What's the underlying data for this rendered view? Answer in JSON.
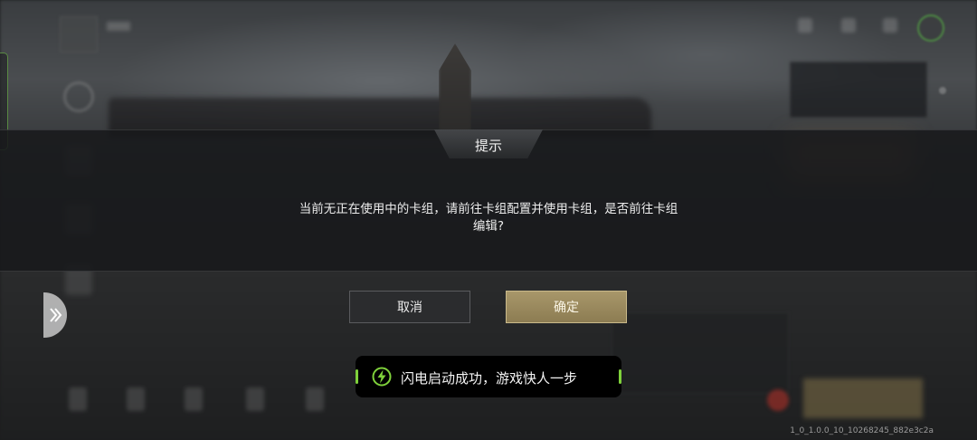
{
  "dialog": {
    "title": "提示",
    "message_line1": "当前无正在使用中的卡组，请前往卡组配置并使用卡组，是否前往卡组",
    "message_line2": "编辑?",
    "cancel_label": "取消",
    "confirm_label": "确定"
  },
  "toast": {
    "text": "闪电启动成功，游戏快人一步",
    "icon": "lightning-icon",
    "accent": "#7fd13b"
  },
  "version": "1_0_1.0.0_10_10268245_882e3c2a",
  "colors": {
    "confirm_gold": "#a8976a",
    "cancel_dark": "#2b2c2e"
  }
}
